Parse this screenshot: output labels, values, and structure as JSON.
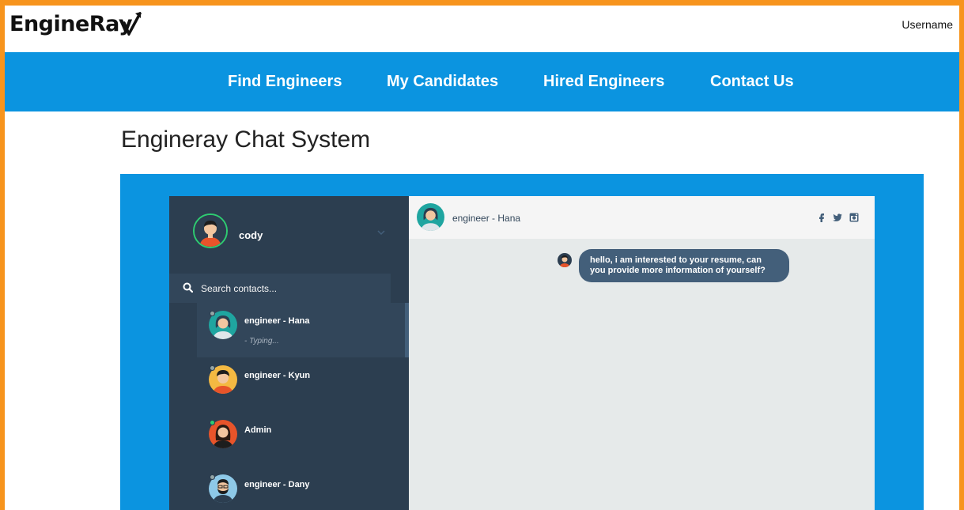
{
  "brand": {
    "logo_text": "EngineRay",
    "username": "Username"
  },
  "nav": {
    "items": [
      "Find Engineers",
      "My Candidates",
      "Hired Engineers",
      "Contact Us"
    ]
  },
  "page": {
    "title": "Engineray Chat System"
  },
  "profile": {
    "name": "cody"
  },
  "search": {
    "placeholder": "Search contacts..."
  },
  "contacts": [
    {
      "name": "engineer - Hana",
      "preview": "- Typing...",
      "status_color": "#95a5a6",
      "active": true
    },
    {
      "name": "engineer - Kyun",
      "preview": "",
      "status_color": "#95a5a6",
      "active": false
    },
    {
      "name": "Admin",
      "preview": "",
      "status_color": "#2ecc71",
      "active": false
    },
    {
      "name": "engineer - Dany",
      "preview": "",
      "status_color": "#95a5a6",
      "active": false
    }
  ],
  "chat": {
    "contact_name": "engineer - Hana",
    "social_icons": [
      "facebook-icon",
      "twitter-icon",
      "instagram-icon"
    ],
    "messages": [
      {
        "text": "hello, i am interested to your resume, can you provide more information of yourself?"
      }
    ]
  },
  "colors": {
    "frame": "#f7941d",
    "nav_bg": "#0b94e0",
    "sidebar_bg": "#2c3e50",
    "sidebar_active": "#32465a",
    "bubble": "#435f7a",
    "panel_bg": "#e6eaea"
  }
}
